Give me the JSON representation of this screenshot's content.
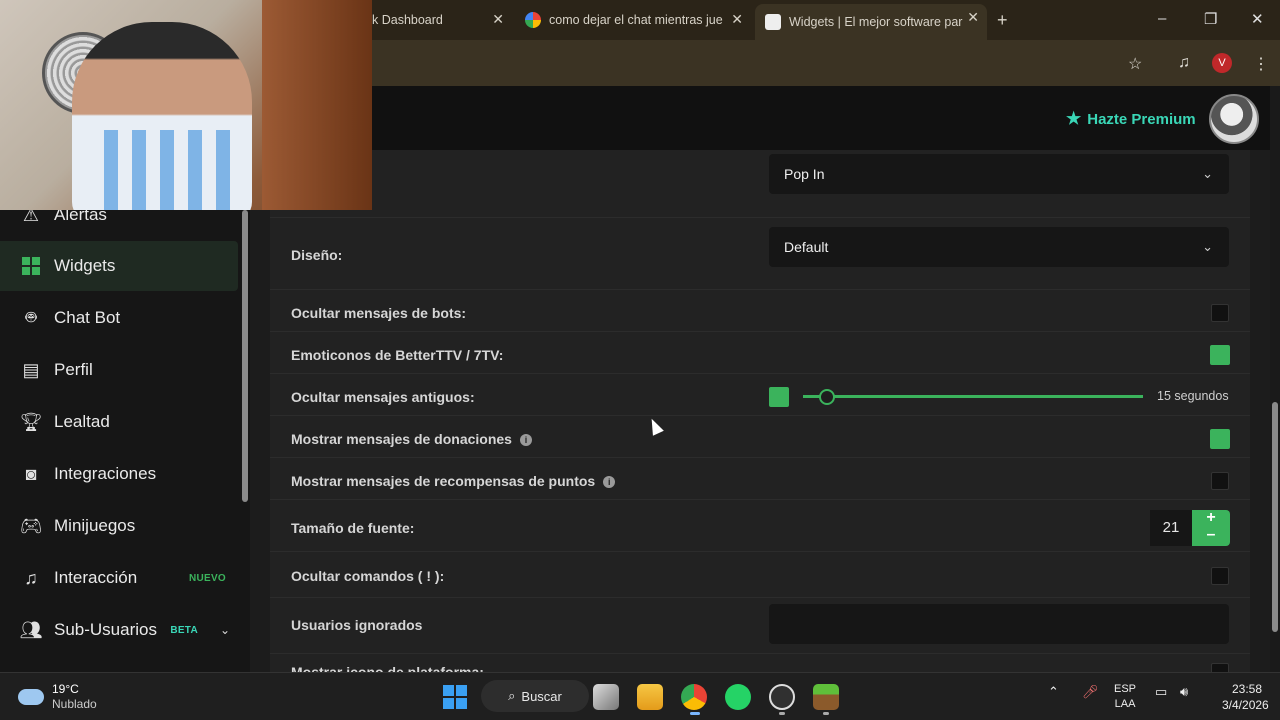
{
  "browser": {
    "tabs": [
      {
        "title": "k Dashboard",
        "active": false
      },
      {
        "title": "como dejar el chat mientras jue",
        "active": false
      },
      {
        "title": "Widgets | El mejor software par",
        "active": true
      }
    ],
    "new_tab_label": "+",
    "profile_initial": "V",
    "window_controls": {
      "minimize": "–",
      "restore": "❐",
      "close": "✕"
    }
  },
  "header": {
    "premium_label": "Hazte Premium",
    "premium_color": "#3ad7b7"
  },
  "sidebar": {
    "items": [
      {
        "label": "Alertas",
        "icon": "warning-icon"
      },
      {
        "label": "Widgets",
        "icon": "grid-icon",
        "active": true
      },
      {
        "label": "Chat Bot",
        "icon": "robot-icon"
      },
      {
        "label": "Perfil",
        "icon": "id-card-icon"
      },
      {
        "label": "Lealtad",
        "icon": "trophy-icon"
      },
      {
        "label": "Integraciones",
        "icon": "discord-icon"
      },
      {
        "label": "Minijuegos",
        "icon": "gamepad-icon"
      },
      {
        "label": "Interacción",
        "icon": "music-icon",
        "badge": "NUEVO",
        "badge_color": "#3bb35c"
      },
      {
        "label": "Sub-Usuarios",
        "icon": "users-icon",
        "badge": "BETA",
        "badge_color": "#3ad7b7"
      }
    ]
  },
  "settings": {
    "animation_select": "Pop In",
    "design_label": "Diseño:",
    "design_select": "Default",
    "hide_bots_label": "Ocultar mensajes de bots:",
    "hide_bots_checked": false,
    "emotes_label": "Emoticonos de BetterTTV / 7TV:",
    "emotes_checked": true,
    "hide_old_label": "Ocultar mensajes antiguos:",
    "hide_old_checked": true,
    "hide_old_slider_fraction": 0.07,
    "hide_old_value": "15 segundos",
    "donations_label": "Mostrar mensajes de donaciones",
    "donations_checked": true,
    "rewards_label": "Mostrar mensajes de recompensas de puntos",
    "rewards_checked": false,
    "font_size_label": "Tamaño de fuente:",
    "font_size_value": "21",
    "hide_commands_label": "Ocultar comandos ( ! ):",
    "hide_commands_checked": false,
    "ignored_users_label": "Usuarios ignorados",
    "ignored_users_value": "",
    "partial_next_label": "Mostrar icono de plataforma:",
    "accent_color": "#3bb35c"
  },
  "taskbar": {
    "weather_temp": "19°C",
    "weather_desc": "Nublado",
    "search_label": "Buscar",
    "lang_line1": "ESP",
    "lang_line2": "LAA",
    "time": "23:58",
    "date": "3/4/2026"
  }
}
